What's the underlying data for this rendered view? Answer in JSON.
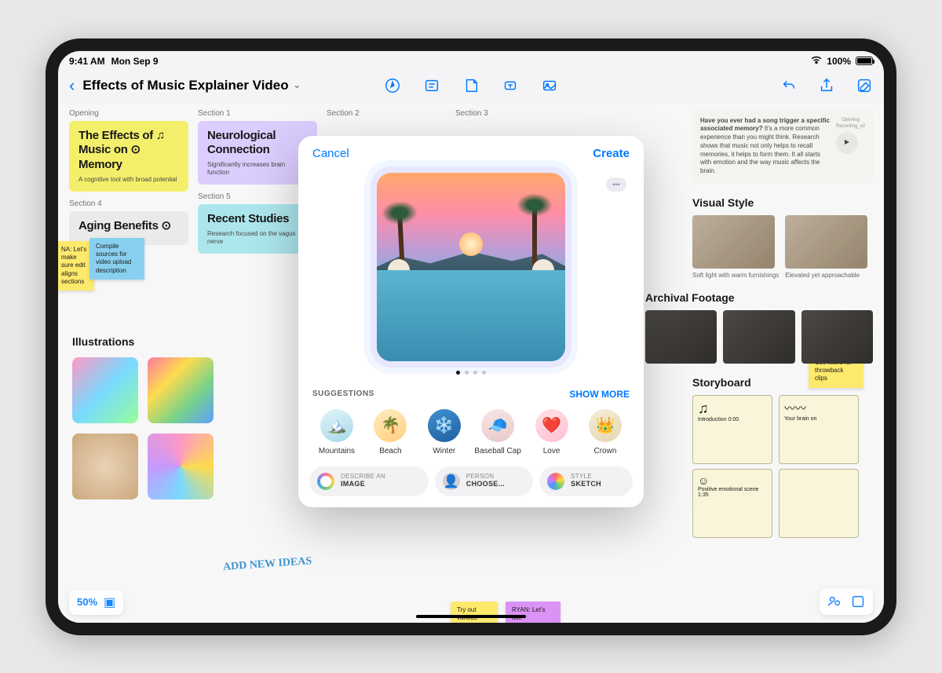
{
  "status": {
    "time": "9:41 AM",
    "date": "Mon Sep 9",
    "battery": "100%"
  },
  "toolbar": {
    "title": "Effects of Music Explainer Video"
  },
  "sections": {
    "labels": [
      "Opening",
      "Section 1",
      "Section 2",
      "Section 3",
      "Section 4",
      "Section 5"
    ],
    "cards": [
      {
        "title": "The Effects of ♫ Music on ⊙ Memory",
        "sub": "A cognitive tool with broad potential"
      },
      {
        "title": "Neurological Connection",
        "sub": "Significantly increases brain function"
      },
      {
        "title": "Aging Benefits ⊙",
        "sub": ""
      },
      {
        "title": "Recent Studies",
        "sub": "Research focused on the vagus nerve"
      }
    ]
  },
  "stickies": {
    "a": "NA: Let's make sure edit aligns sections",
    "b": "Compile sources for video upload description",
    "c": "Use filters for throwback clips",
    "d": "Try out various",
    "e": "RYAN: Let's use"
  },
  "note": {
    "text": "Have you ever had a song trigger a specific associated memory? It's a more common experience than you might think. Research shows that music not only helps to recall memories, it helps to form them. It all starts with emotion and the way music affects the brain.",
    "file": "Opening Recording_v2"
  },
  "headings": {
    "illustrations": "Illustrations",
    "visual": "Visual Style",
    "archival": "Archival Footage",
    "storyboard": "Storyboard"
  },
  "visual_labels": [
    "Soft light with warm furnishings",
    "Elevated yet approachable"
  ],
  "storyboard_labels": [
    "Introduction 0:00",
    "Your brain on",
    "Positive emotional scene 1:35"
  ],
  "handwriting": "ADD NEW IDEAS",
  "zoom": "50%",
  "modal": {
    "cancel": "Cancel",
    "create": "Create",
    "suggestions_label": "SUGGESTIONS",
    "show_more": "SHOW MORE",
    "items": [
      "Mountains",
      "Beach",
      "Winter",
      "Baseball Cap",
      "Love",
      "Crown"
    ],
    "chips": {
      "describe": {
        "label": "DESCRIBE AN",
        "value": "IMAGE"
      },
      "person": {
        "label": "PERSON",
        "value": "CHOOSE..."
      },
      "style": {
        "label": "STYLE",
        "value": "SKETCH"
      }
    }
  }
}
